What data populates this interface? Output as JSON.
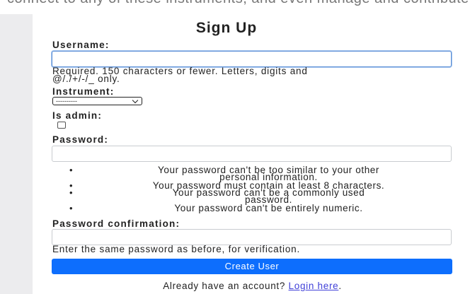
{
  "browser": {
    "top_partial_text": "connect to any of these instruments, and even manage and contribute to other instruments just like you do for yours."
  },
  "form": {
    "title": "Sign Up",
    "username": {
      "label": "Username:",
      "value": "",
      "help_line1": "Required. 150 characters or fewer. Letters, digits and",
      "help_line2": "@/./+/-/_ only."
    },
    "instrument": {
      "label": "Instrument:",
      "selected": "----------"
    },
    "is_admin": {
      "label": "Is admin:",
      "checked": false
    },
    "password": {
      "label": "Password:",
      "value": "",
      "rules": [
        {
          "line1": "Your password can't be too similar to your other",
          "line2": "personal information."
        },
        {
          "line1": "Your password must contain at least 8 characters.",
          "line2": ""
        },
        {
          "line1": "Your password can't be a commonly used",
          "line2": "password."
        },
        {
          "line1": "Your password can't be entirely numeric.",
          "line2": ""
        }
      ]
    },
    "password_confirmation": {
      "label": "Password confirmation:",
      "value": "",
      "help": "Enter the same password as before, for verification."
    },
    "submit_label": "Create User",
    "footer_text": "Already have an account? ",
    "login_link": "Login here",
    "footer_end": "."
  },
  "colors": {
    "primary_button": "#0d6efd",
    "link": "#4040d8",
    "gutter": "#ececee"
  }
}
